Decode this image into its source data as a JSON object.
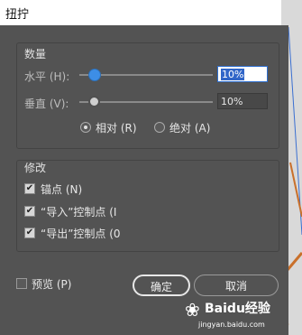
{
  "window": {
    "title": "扭拧"
  },
  "quantity": {
    "title": "数量",
    "horizontal": {
      "label": "水平 (H):",
      "value": "10%"
    },
    "vertical": {
      "label": "垂直 (V):",
      "value": "10%"
    },
    "relative_label": "相对 (R)",
    "absolute_label": "绝对 (A)",
    "selected": "relative"
  },
  "modify": {
    "title": "修改",
    "items": [
      {
        "label": "锚点 (N)",
        "checked": true
      },
      {
        "label": "“导入”控制点 (I",
        "checked": true
      },
      {
        "label": "“导出”控制点 (0",
        "checked": true
      }
    ]
  },
  "footer": {
    "preview_label": "预览 (P)",
    "preview_checked": false,
    "ok_label": "确定",
    "cancel_label": "取消"
  },
  "watermark": {
    "text": "Baidu经验",
    "url": "jingyan.baidu.com"
  },
  "colors": {
    "dialog_bg": "#535353",
    "accent": "#3d8ee6"
  }
}
